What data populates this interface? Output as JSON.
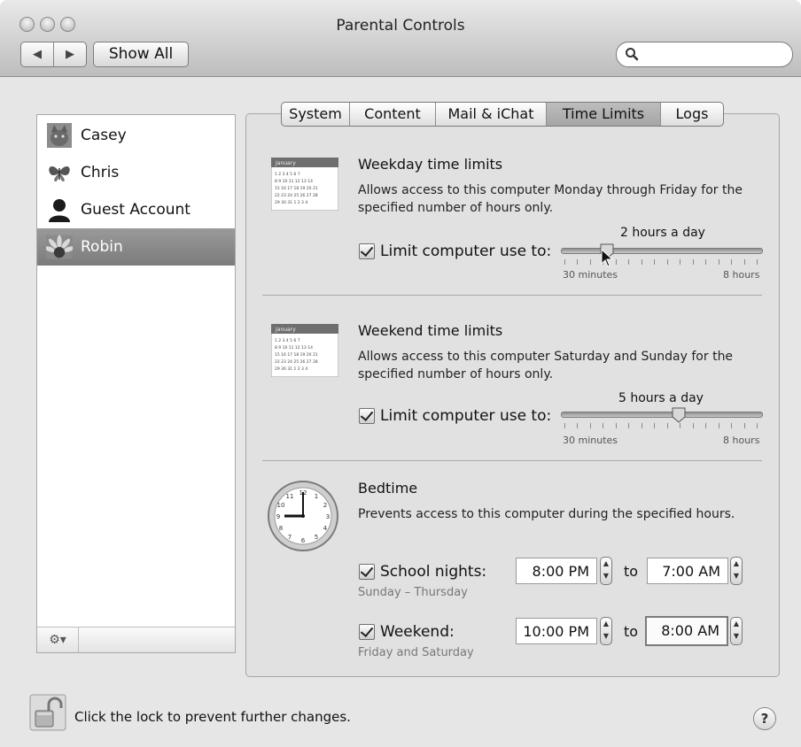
{
  "window": {
    "title": "Parental Controls"
  },
  "toolbar": {
    "back_label": "◀",
    "forward_label": "▶",
    "show_all_label": "Show All",
    "search_placeholder": ""
  },
  "sidebar": {
    "users": [
      {
        "name": "Casey",
        "icon": "cat-avatar-icon",
        "selected": false
      },
      {
        "name": "Chris",
        "icon": "butterfly-avatar-icon",
        "selected": false
      },
      {
        "name": "Guest Account",
        "icon": "silhouette-avatar-icon",
        "selected": false
      },
      {
        "name": "Robin",
        "icon": "flower-avatar-icon",
        "selected": true
      }
    ],
    "gear_label": "⚙▾"
  },
  "tabs": {
    "items": [
      "System",
      "Content",
      "Mail & iChat",
      "Time Limits",
      "Logs"
    ],
    "active": "Time Limits"
  },
  "weekday": {
    "title": "Weekday time limits",
    "description": "Allows access to this computer Monday through Friday for the specified number of hours only.",
    "checkbox_label": "Limit computer use to:",
    "checked": true,
    "value_label": "2 hours a day",
    "min_label": "30 minutes",
    "max_label": "8 hours",
    "slider_fraction": 0.22
  },
  "weekend": {
    "title": "Weekend time limits",
    "description": "Allows access to this computer Saturday and Sunday for the specified number of hours only.",
    "checkbox_label": "Limit computer use to:",
    "checked": true,
    "value_label": "5 hours a day",
    "min_label": "30 minutes",
    "max_label": "8 hours",
    "slider_fraction": 0.59
  },
  "bedtime": {
    "title": "Bedtime",
    "description": "Prevents access to this computer during the specified hours.",
    "school_nights": {
      "label": "School nights:",
      "checked": true,
      "sub": "Sunday – Thursday",
      "from": "8:00 PM",
      "to_word": "to",
      "to": "7:00 AM"
    },
    "weekend": {
      "label": "Weekend:",
      "checked": true,
      "sub": "Friday and Saturday",
      "from": "10:00 PM",
      "to_word": "to",
      "to": "8:00 AM"
    }
  },
  "calendar_icon": {
    "month": "January"
  },
  "footer": {
    "lock_text": "Click the lock to prevent further changes.",
    "help_label": "?"
  }
}
